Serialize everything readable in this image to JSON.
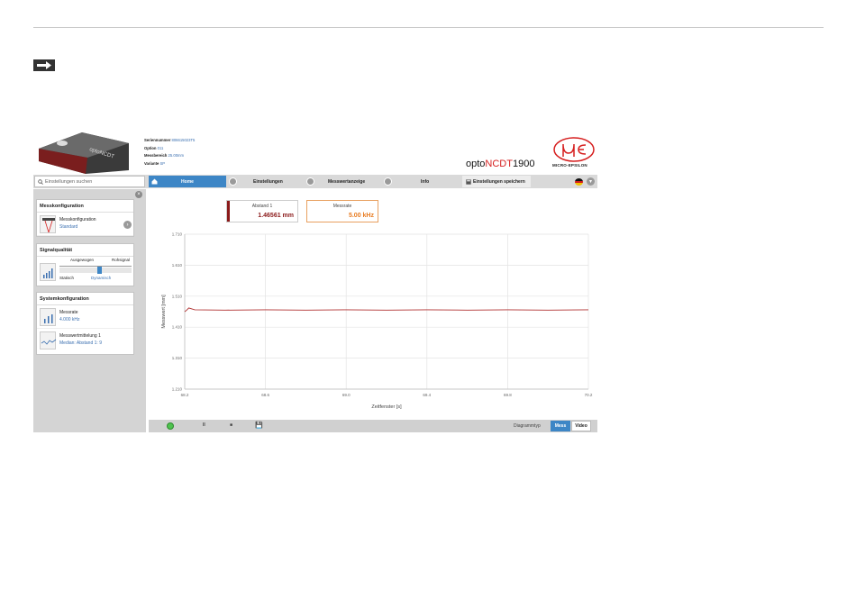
{
  "header": {
    "info": [
      {
        "label": "Seriennummer",
        "value": "806615023T5"
      },
      {
        "label": "Option",
        "value": "011"
      },
      {
        "label": "Messbereich",
        "value": "25.00mm"
      },
      {
        "label": "Variante",
        "value": "SP"
      }
    ],
    "brand_prefix": "opto",
    "brand_red": "NCDT",
    "brand_suffix": "1900",
    "logo_text": "MICRO-EPSILON"
  },
  "nav": {
    "search_placeholder": "Einstellungen suchen",
    "home": "Home",
    "settings": "Einstellungen",
    "display": "Messwertanzeige",
    "info": "Info",
    "save": "Einstellungen speichern"
  },
  "sidebar": {
    "messkonfig": {
      "title": "Messkonfiguration",
      "label": "Messkonfiguration",
      "value": "Standard"
    },
    "signal": {
      "title": "Signalqualität",
      "top_left": "Ausgewogen",
      "top_right": "Rohsignal",
      "bottom_left": "Statisch",
      "bottom_mid": "Dynamisch"
    },
    "system": {
      "title": "Systemkonfiguration",
      "items": [
        {
          "label": "Messrate",
          "value": "4.000 kHz"
        },
        {
          "label": "Messwertmittelung 1",
          "value": "Median: Abstand 1: 9"
        }
      ]
    }
  },
  "cards": [
    {
      "label": "Abstand 1",
      "value": "1.46561 mm",
      "color": "#8b1a1a"
    },
    {
      "label": "Messrate",
      "value": "5.00 kHz",
      "color": "#e87a1e"
    }
  ],
  "chart_data": {
    "type": "line",
    "xlabel": "Zeitfenster [s]",
    "ylabel": "Messwert [mm]",
    "x_ticks": [
      "68.2",
      "68.6",
      "69.0",
      "69.4",
      "69.8",
      "70.2"
    ],
    "y_ticks": [
      "1.710",
      "1.610",
      "1.510",
      "1.410",
      "1.310",
      "1.210"
    ],
    "xlim": [
      68.2,
      70.2
    ],
    "ylim": [
      1.21,
      1.71
    ],
    "series": [
      {
        "color": "#b03030",
        "x": [
          68.2,
          68.21,
          68.22,
          68.25,
          68.4,
          68.6,
          68.8,
          69.0,
          69.2,
          69.4,
          69.6,
          69.8,
          70.0,
          70.2
        ],
        "y": [
          1.46,
          1.465,
          1.472,
          1.466,
          1.465,
          1.466,
          1.465,
          1.466,
          1.465,
          1.466,
          1.465,
          1.466,
          1.465,
          1.466
        ]
      }
    ]
  },
  "toolbar": {
    "pause": "II",
    "stop": "■",
    "save": "💾",
    "diagram_type": "Diagrammtyp",
    "mess": "Mess",
    "video": "Video"
  }
}
